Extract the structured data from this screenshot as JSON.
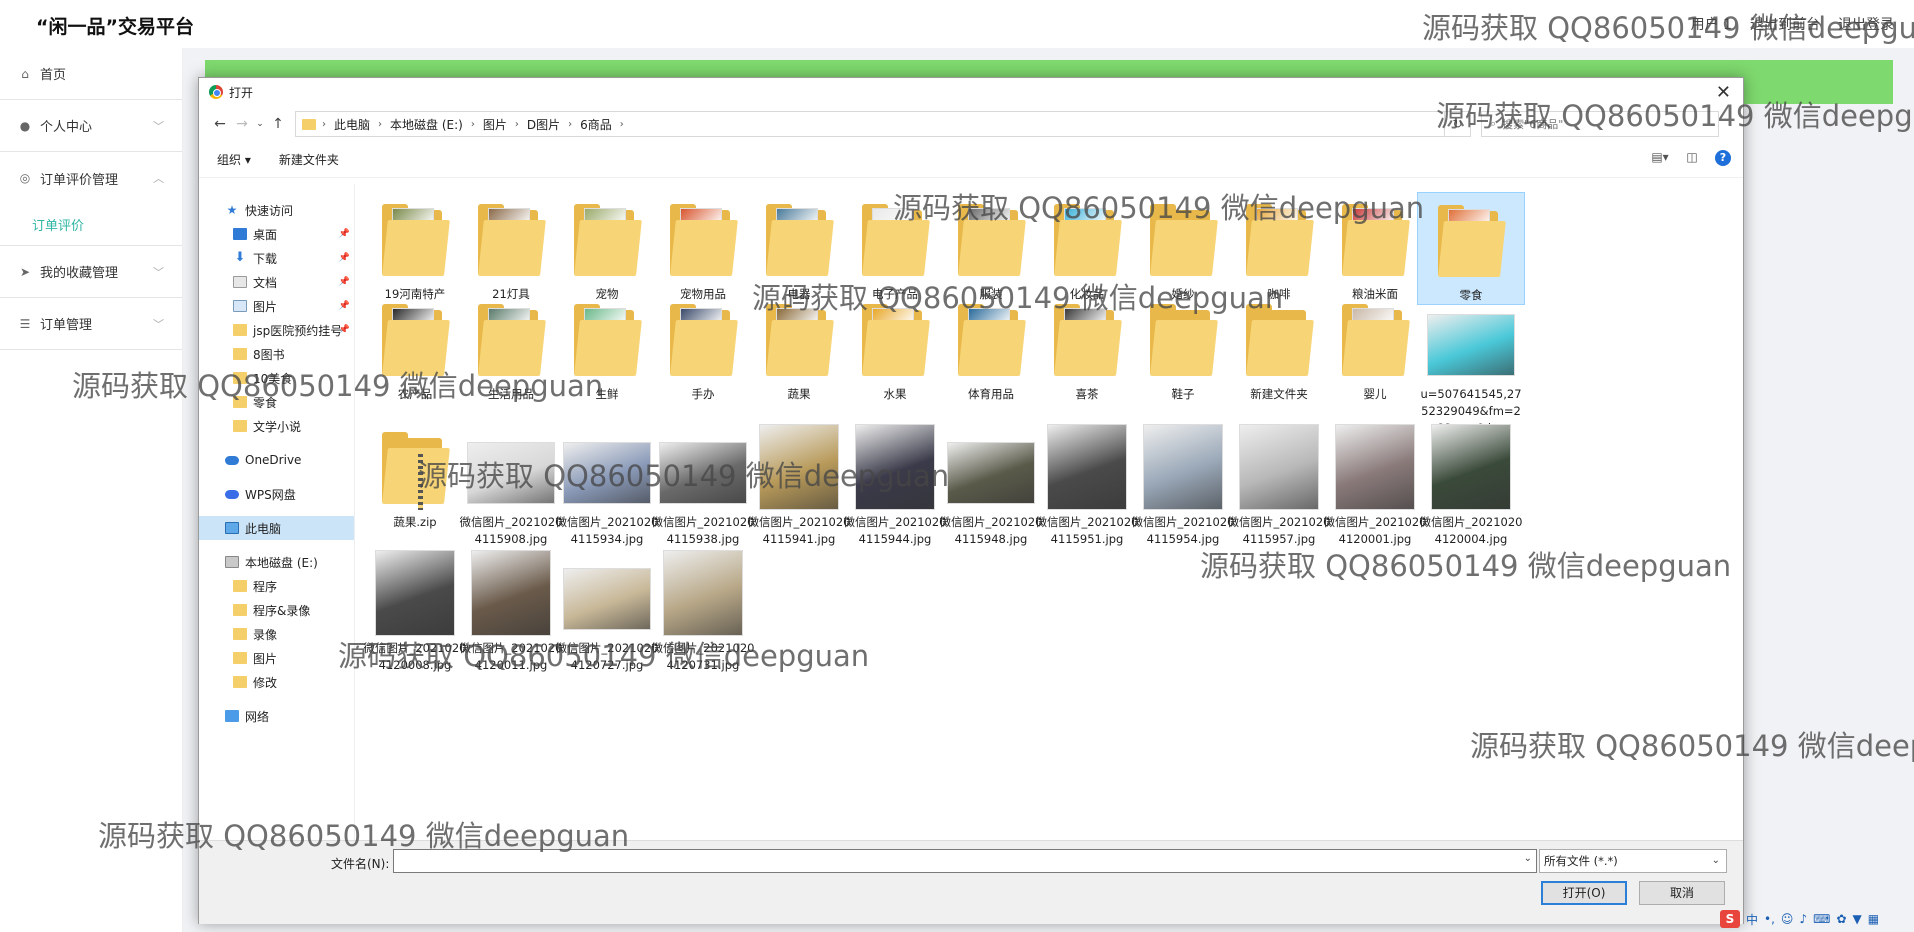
{
  "app": {
    "title": "“闲一品”交易平台",
    "header_links": [
      "用户 1",
      "退出到前台",
      "退出登录"
    ]
  },
  "sidebar": {
    "items": [
      {
        "label": "首页",
        "icon": "home-icon",
        "has_arrow": false
      },
      {
        "label": "个人中心",
        "icon": "user-icon",
        "has_arrow": true
      },
      {
        "label": "订单评价管理",
        "icon": "comment-icon",
        "has_arrow": true,
        "arrow": "up"
      },
      {
        "label": "我的收藏管理",
        "icon": "send-icon",
        "has_arrow": true
      },
      {
        "label": "订单管理",
        "icon": "sliders-icon",
        "has_arrow": true
      }
    ],
    "submenu": {
      "label": "订单评价",
      "color": "#2fb7a4"
    }
  },
  "dialog": {
    "title": "打开",
    "breadcrumb": [
      "此电脑",
      "本地磁盘 (E:)",
      "图片",
      "D图片",
      "6商品"
    ],
    "search_placeholder": "搜索\"6商品\"",
    "toolbar": {
      "organize": "组织 ▾",
      "new_folder": "新建文件夹"
    },
    "nav": [
      {
        "label": "快速访问",
        "icon": "star",
        "level": 1
      },
      {
        "label": "桌面",
        "icon": "desk",
        "level": 2,
        "pinned": true
      },
      {
        "label": "下载",
        "icon": "down",
        "level": 2,
        "pinned": true
      },
      {
        "label": "文档",
        "icon": "doc",
        "level": 2,
        "pinned": true
      },
      {
        "label": "图片",
        "icon": "pic",
        "level": 2,
        "pinned": true
      },
      {
        "label": "jsp医院预约挂号",
        "icon": "folder",
        "level": 2,
        "pinned": true
      },
      {
        "label": "8图书",
        "icon": "folder",
        "level": 2
      },
      {
        "label": "10美食",
        "icon": "folder",
        "level": 2
      },
      {
        "label": "零食",
        "icon": "folder",
        "level": 2
      },
      {
        "label": "文学小说",
        "icon": "folder",
        "level": 2
      },
      {
        "label": "OneDrive",
        "icon": "cloud",
        "level": 1,
        "gap": true
      },
      {
        "label": "WPS网盘",
        "icon": "wps",
        "level": 1,
        "gap": true
      },
      {
        "label": "此电脑",
        "icon": "pc",
        "level": 1,
        "gap": true,
        "selected": true
      },
      {
        "label": "本地磁盘 (E:)",
        "icon": "disk",
        "level": 1,
        "gap": true
      },
      {
        "label": "程序",
        "icon": "folder",
        "level": 2
      },
      {
        "label": "程序&录像",
        "icon": "folder",
        "level": 2
      },
      {
        "label": "录像",
        "icon": "folder",
        "level": 2
      },
      {
        "label": "图片",
        "icon": "folder",
        "level": 2
      },
      {
        "label": "修改",
        "icon": "folder",
        "level": 2
      },
      {
        "label": "网络",
        "icon": "net",
        "level": 1,
        "gap": true
      }
    ],
    "files": [
      {
        "name": "19河南特产",
        "kind": "folder",
        "tint": "#7a8a4a"
      },
      {
        "name": "21灯具",
        "kind": "folder",
        "tint": "#8a6a4a"
      },
      {
        "name": "宠物",
        "kind": "folder",
        "tint": "#9aaa6a"
      },
      {
        "name": "宠物用品",
        "kind": "folder",
        "tint": "#d8552e"
      },
      {
        "name": "电器",
        "kind": "folder",
        "tint": "#4a7a9a"
      },
      {
        "name": "电子产品",
        "kind": "folder",
        "tint": "#e8e8e8"
      },
      {
        "name": "服装",
        "kind": "folder",
        "tint": "#6a6a6a"
      },
      {
        "name": "化妆品",
        "kind": "folder",
        "tint": "#3ab0d8"
      },
      {
        "name": "婚纱",
        "kind": "folder",
        "tint": "#f7d475"
      },
      {
        "name": "咖啡",
        "kind": "folder",
        "tint": "#e8a83a"
      },
      {
        "name": "粮油米面",
        "kind": "folder",
        "tint": "#c83a3a"
      },
      {
        "name": "零食",
        "kind": "folder",
        "tint": "#e0703a",
        "selected": true
      },
      {
        "name": "农产品",
        "kind": "folder",
        "tint": "#2a2a2a"
      },
      {
        "name": "生活用品",
        "kind": "folder",
        "tint": "#5a7a6a"
      },
      {
        "name": "生鲜",
        "kind": "folder",
        "tint": "#6ab88a"
      },
      {
        "name": "手办",
        "kind": "folder",
        "tint": "#3a4a6a"
      },
      {
        "name": "蔬果",
        "kind": "folder",
        "tint": "#8a6a3a"
      },
      {
        "name": "水果",
        "kind": "folder",
        "tint": "#e8a82a"
      },
      {
        "name": "体育用品",
        "kind": "folder",
        "tint": "#2a6a9a"
      },
      {
        "name": "喜茶",
        "kind": "folder",
        "tint": "#3a3a3a"
      },
      {
        "name": "鞋子",
        "kind": "folder",
        "tint": "#f7d475"
      },
      {
        "name": "新建文件夹",
        "kind": "folder",
        "tint": "#f7d475"
      },
      {
        "name": "婴儿",
        "kind": "folder",
        "tint": "#c8b8a8"
      },
      {
        "name": "u=507641545,2752329049&fm=26&gp=0.jpg",
        "kind": "image-wide",
        "tint": "#4ac8d8"
      },
      {
        "name": "蔬果.zip",
        "kind": "zip",
        "tint": "#f7d475"
      },
      {
        "name": "微信图片_20210204115908.jpg",
        "kind": "image-wide",
        "tint": "#d8d8d8"
      },
      {
        "name": "微信图片_20210204115934.jpg",
        "kind": "image-wide",
        "tint": "#8a9ab8"
      },
      {
        "name": "微信图片_20210204115938.jpg",
        "kind": "image-wide",
        "tint": "#6a6a6a"
      },
      {
        "name": "微信图片_20210204115941.jpg",
        "kind": "image",
        "tint": "#b89a5a"
      },
      {
        "name": "微信图片_20210204115944.jpg",
        "kind": "image",
        "tint": "#3a3a4a"
      },
      {
        "name": "微信图片_20210204115948.jpg",
        "kind": "image-wide",
        "tint": "#5a5a4a"
      },
      {
        "name": "微信图片_20210204115951.jpg",
        "kind": "image",
        "tint": "#4a4a4a"
      },
      {
        "name": "微信图片_20210204115954.jpg",
        "kind": "image",
        "tint": "#9aa8b8"
      },
      {
        "name": "微信图片_20210204115957.jpg",
        "kind": "image",
        "tint": "#b8b8b8"
      },
      {
        "name": "微信图片_20210204120001.jpg",
        "kind": "image",
        "tint": "#8a7a7a"
      },
      {
        "name": "微信图片_20210204120004.jpg",
        "kind": "image",
        "tint": "#3a4a3a"
      },
      {
        "name": "微信图片_20210204120008.jpg",
        "kind": "image",
        "tint": "#4a4a4a"
      },
      {
        "name": "微信图片_20210204120011.jpg",
        "kind": "image",
        "tint": "#6a5a4a"
      },
      {
        "name": "微信图片_20210204120727.jpg",
        "kind": "image-wide",
        "tint": "#c8b898"
      },
      {
        "name": "微信图片_20210204120731.jpg",
        "kind": "image",
        "tint": "#b8a888"
      }
    ],
    "filename_label": "文件名(N):",
    "filename_value": "",
    "filetype": "所有文件 (*.*)",
    "open_button": "打开(O)",
    "cancel_button": "取消"
  },
  "ime": {
    "label": "中"
  },
  "watermarks": [
    "源码获取 QQ86050149 微信deepguan",
    "源码获取 QQ86050149 微信deepguan",
    "源码获取 QQ86050149 微信deepguan",
    "源码获取 QQ86050149 微信deepguan",
    "源码获取 QQ86050149 微信deepguan",
    "源码获取 QQ86050149 微信deepguan",
    "源码获取 QQ86050149 微信deepguan",
    "源码获取 QQ86050149 微信deepguan",
    "源码获取 QQ86050149 微信deepguan",
    "源码获取 QQ86050149 微信deepguan"
  ]
}
